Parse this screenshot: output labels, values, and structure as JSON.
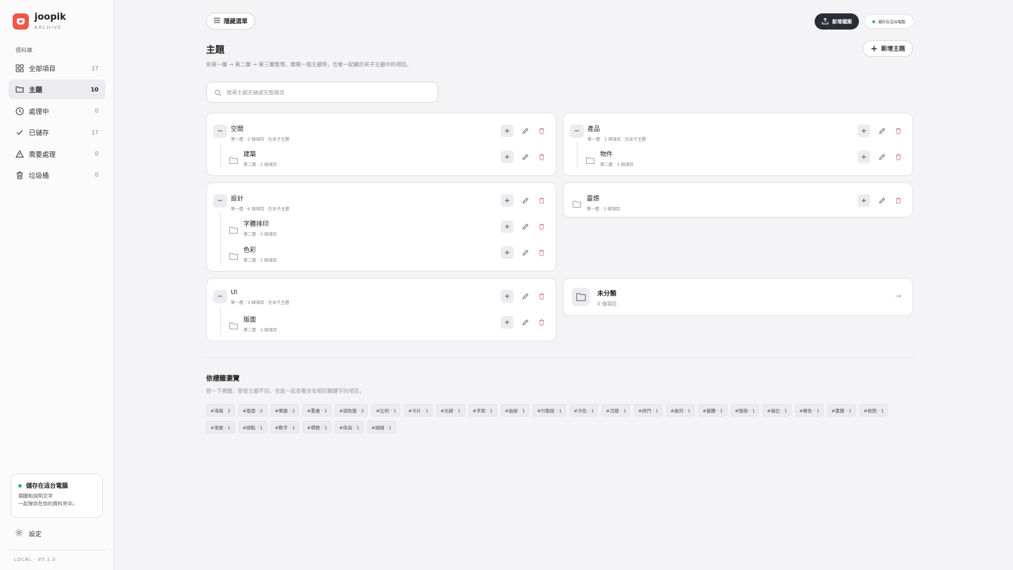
{
  "brand": {
    "name": "joopik",
    "sub": "ARCHIVE"
  },
  "sidebar": {
    "section_label": "資料庫",
    "items": [
      {
        "label": "全部項目",
        "count": "17",
        "icon": "grid-icon"
      },
      {
        "label": "主題",
        "count": "10",
        "icon": "folder-icon"
      },
      {
        "label": "處理中",
        "count": "0",
        "icon": "clock-icon"
      },
      {
        "label": "已儲存",
        "count": "17",
        "icon": "check-icon"
      },
      {
        "label": "需要處理",
        "count": "0",
        "icon": "warning-icon"
      },
      {
        "label": "垃圾桶",
        "count": "0",
        "icon": "trash-icon"
      }
    ],
    "active_index": 1,
    "storage": {
      "title": "儲存在這台電腦",
      "line1": "擷圖和說明文字",
      "line2": "一起保存在你的資料夾中。"
    },
    "settings_label": "設定",
    "version": "LOCAL · V0.1.0"
  },
  "topbar": {
    "hide_menu_label": "隱藏選單",
    "new_file_label": "新增檔案",
    "local_badge_label": "儲存在這台電腦"
  },
  "header": {
    "title": "主題",
    "description": "依第一層 → 第二層 → 第三層整理。展開一個主題時，也會一起顯示其子主題中的項目。",
    "new_topic_label": "新增主題",
    "search_placeholder": "搜尋主題名稱或完整路徑"
  },
  "topics": [
    {
      "title": "空間",
      "meta": "第一層 · 2 個項目 · 包含子主題",
      "children": [
        {
          "title": "建築",
          "meta": "第二層 · 2 個項目"
        }
      ]
    },
    {
      "title": "產品",
      "meta": "第一層 · 3 個項目 · 包含子主題",
      "children": [
        {
          "title": "物件",
          "meta": "第二層 · 3 個項目"
        }
      ]
    },
    {
      "title": "設計",
      "meta": "第一層 · 6 個項目 · 包含子主題",
      "children": [
        {
          "title": "字體排印",
          "meta": "第二層 · 3 個項目"
        },
        {
          "title": "色彩",
          "meta": "第二層 · 3 個項目"
        }
      ]
    },
    {
      "title": "靈感",
      "meta": "第一層 · 3 個項目",
      "children": []
    },
    {
      "title": "UI",
      "meta": "第一層 · 3 個項目 · 包含子主題",
      "children": [
        {
          "title": "版面",
          "meta": "第二層 · 3 個項目"
        }
      ]
    }
  ],
  "uncategorized": {
    "title": "未分類",
    "count": "0 個項目"
  },
  "tags_section": {
    "title": "依標籤瀏覽",
    "description": "按一下標籤，即使主題不同，也能一起查看含有相同關鍵字的項目。",
    "tags": [
      "#海報 · 2",
      "#版面 · 2",
      "#樂趣 · 2",
      "#重複 · 2",
      "#調色盤 · 2",
      "#比例 · 1",
      "#卡片 · 1",
      "#光線 · 1",
      "#字距 · 1",
      "#曲線 · 1",
      "#行動版 · 1",
      "#冷色 · 1",
      "#沉穩 · 1",
      "#拱門 · 1",
      "#幾何 · 1",
      "#量體 · 1",
      "#階梯 · 1",
      "#撥記 · 1",
      "#暖色 · 1",
      "#書籍 · 1",
      "#極簡 · 1",
      "#漸層 · 1",
      "#網點 · 1",
      "#數字 · 1",
      "#標題 · 1",
      "#傢具 · 1",
      "#細線 · 1"
    ]
  }
}
